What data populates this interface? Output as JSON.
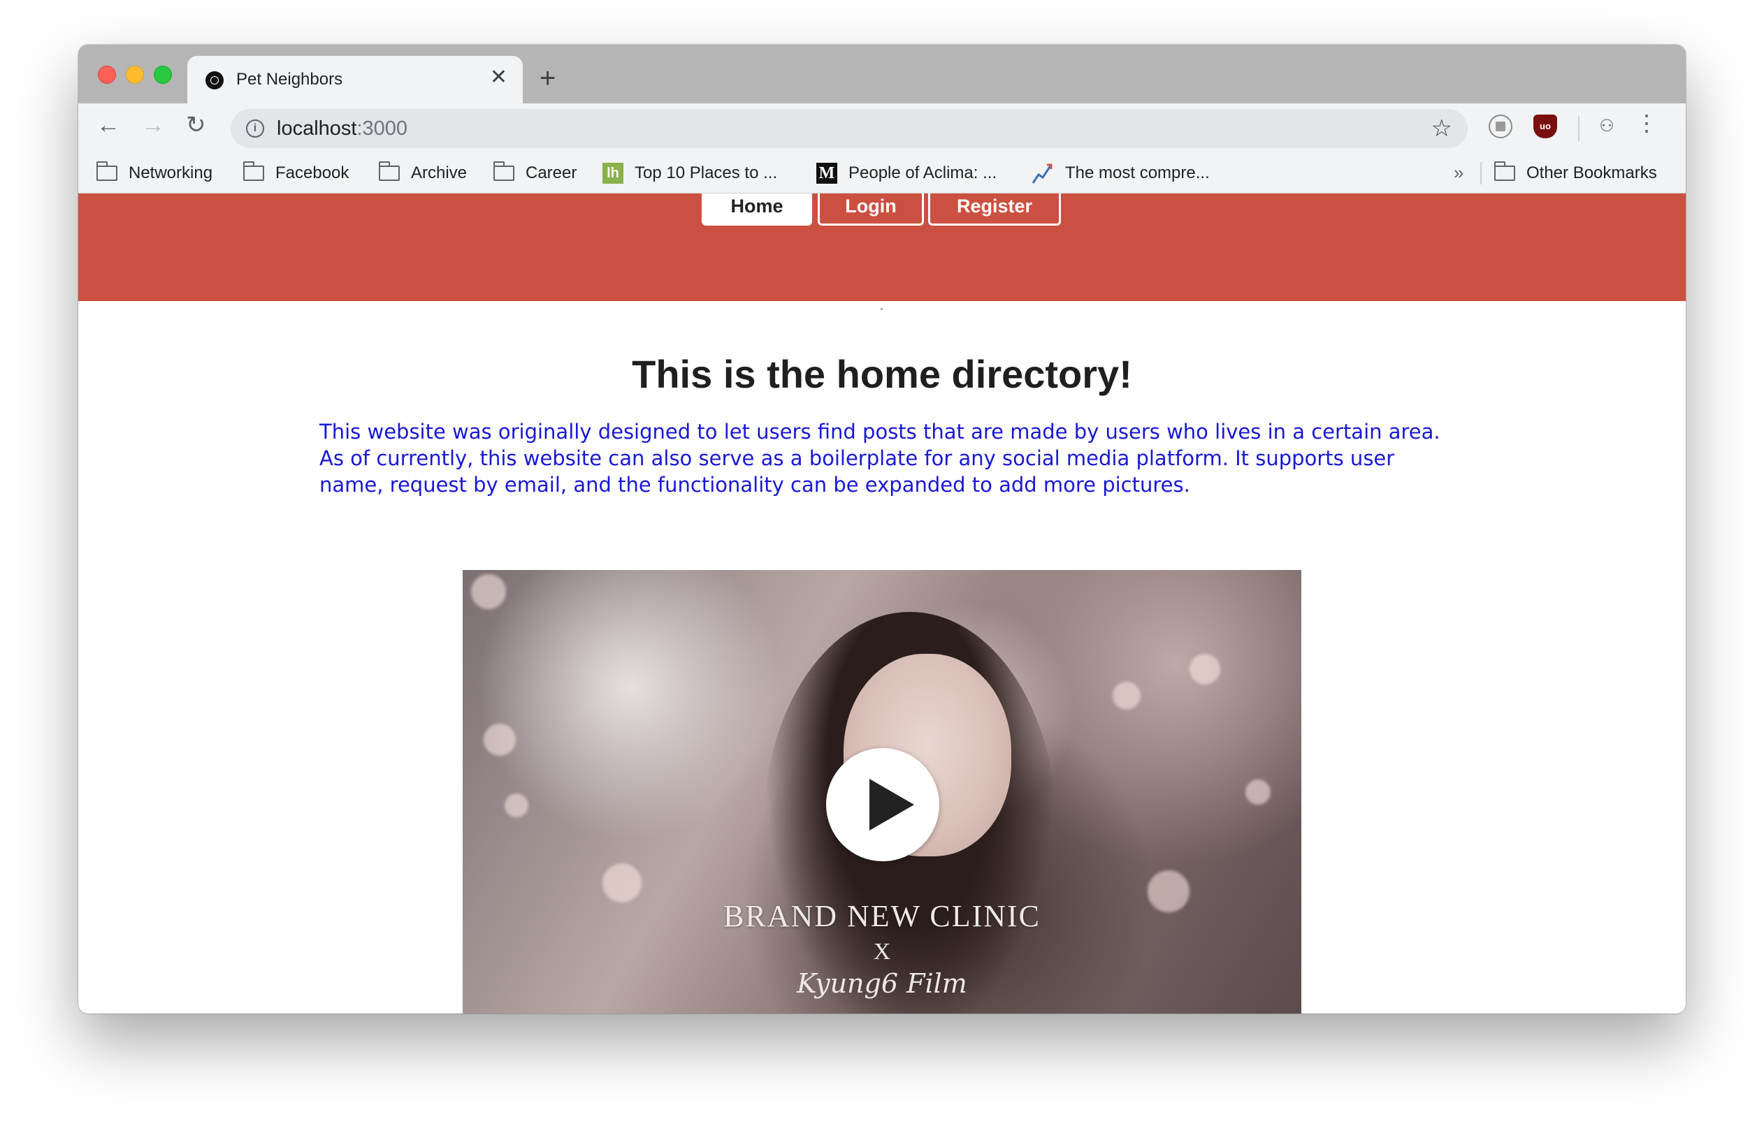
{
  "browser": {
    "tab": {
      "title": "Pet Neighbors",
      "close": "✕",
      "favicon": "dribbble-ball-icon"
    },
    "new_tab": "+",
    "nav": {
      "back": "←",
      "forward": "→",
      "reload": "↻"
    },
    "address": {
      "host": "localhost",
      "port": ":3000",
      "info": "i"
    },
    "star": "☆",
    "menu": "⋮",
    "extensions": {
      "ublock_label": "uo",
      "incognito_glyph": "⚇"
    },
    "bookmarks": [
      {
        "label": "Networking",
        "icon": "folder-icon"
      },
      {
        "label": "Facebook",
        "icon": "folder-icon"
      },
      {
        "label": "Archive",
        "icon": "folder-icon"
      },
      {
        "label": "Career",
        "icon": "folder-icon"
      },
      {
        "label": "Top 10 Places to ...",
        "icon": "lh-favicon",
        "glyph": "lh"
      },
      {
        "label": "People of Aclima: ...",
        "icon": "medium-favicon",
        "glyph": "M"
      },
      {
        "label": "The most compre...",
        "icon": "chart-favicon"
      }
    ],
    "bookmarks_more": "»",
    "other_bookmarks": "Other Bookmarks"
  },
  "page": {
    "nav": {
      "home": "Home",
      "login": "Login",
      "register": "Register"
    },
    "title": "This is the home directory!",
    "intro": "This website was originally designed to let users find posts that are made by users who lives in a certain area. As of currently, this website can also serve as a boilerplate for any social media platform. It supports user name, request by email, and the functionality can be expanded to add more pictures.",
    "video": {
      "caption_line1": "BRAND NEW CLINIC",
      "caption_line2": "X",
      "caption_line3": "Kyung6 Film"
    }
  },
  "colors": {
    "header_band": "#cc5041",
    "intro_text": "#1818d6",
    "tab_bar": "#b5b5b5"
  }
}
